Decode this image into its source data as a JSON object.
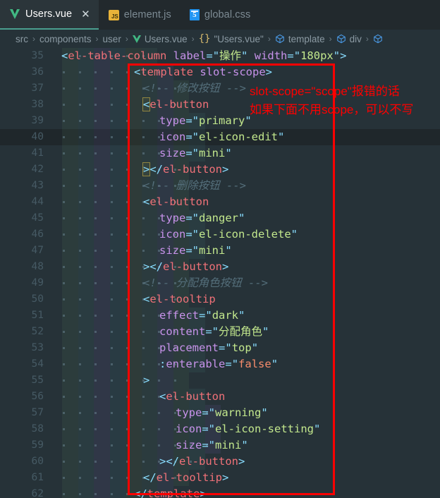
{
  "window": {
    "bg_color": "#263238",
    "accent_color": "#4a9e8f"
  },
  "tabs": [
    {
      "label": "Users.vue",
      "icon": "vue-icon",
      "active": true,
      "close_glyph": "✕"
    },
    {
      "label": "element.js",
      "icon": "js-icon",
      "active": false,
      "icon_text": "JS"
    },
    {
      "label": "global.css",
      "icon": "css-icon",
      "active": false,
      "icon_text": "5"
    }
  ],
  "breadcrumb": {
    "separator": "›",
    "items": [
      {
        "label": "src",
        "icon": ""
      },
      {
        "label": "components",
        "icon": ""
      },
      {
        "label": "user",
        "icon": ""
      },
      {
        "label": "Users.vue",
        "icon": "vue-icon"
      },
      {
        "label": "\"Users.vue\"",
        "icon": "braces-icon"
      },
      {
        "label": "template",
        "icon": "cube-icon"
      },
      {
        "label": "div",
        "icon": "cube-icon"
      },
      {
        "label": "",
        "icon": "cube-icon"
      }
    ]
  },
  "annotation": {
    "color": "#fe0000",
    "line1": "slot-scope=\"scope\"报错的话",
    "line2": "如果下面不用scope，可以不写"
  },
  "editor": {
    "current_line": 40,
    "first_line": 35,
    "last_line": 62,
    "language": "vue",
    "lines": [
      {
        "n": 35,
        "indents": 6,
        "text": "<el-table-column label=\"操作\" width=\"180px\">"
      },
      {
        "n": 36,
        "indents": 7,
        "text": "<template slot-scope>"
      },
      {
        "n": 37,
        "indents": 8,
        "text": "<!-- 修改按钮 --›"
      },
      {
        "n": 38,
        "indents": 8,
        "text": "<el-button"
      },
      {
        "n": 39,
        "indents": 9,
        "text": "type=\"primary\""
      },
      {
        "n": 40,
        "indents": 9,
        "text": "icon=\"el-icon-edit\""
      },
      {
        "n": 41,
        "indents": 9,
        "text": "size=\"mini\""
      },
      {
        "n": 42,
        "indents": 8,
        "text": "></el-button>"
      },
      {
        "n": 43,
        "indents": 8,
        "text": "<!-- 删除按钮 -->"
      },
      {
        "n": 44,
        "indents": 8,
        "text": "<el-button"
      },
      {
        "n": 45,
        "indents": 9,
        "text": "type=\"danger\""
      },
      {
        "n": 46,
        "indents": 9,
        "text": "icon=\"el-icon-delete\""
      },
      {
        "n": 47,
        "indents": 9,
        "text": "size=\"mini\""
      },
      {
        "n": 48,
        "indents": 8,
        "text": "></el-button>"
      },
      {
        "n": 49,
        "indents": 8,
        "text": "<!-- 分配角色按钮 -->"
      },
      {
        "n": 50,
        "indents": 8,
        "text": "<el-tooltip"
      },
      {
        "n": 51,
        "indents": 9,
        "text": "effect=\"dark\""
      },
      {
        "n": 52,
        "indents": 9,
        "text": "content=\"分配角色\""
      },
      {
        "n": 53,
        "indents": 9,
        "text": "placement=\"top\""
      },
      {
        "n": 54,
        "indents": 9,
        "text": ":enterable=\"false\""
      },
      {
        "n": 55,
        "indents": 8,
        "text": ">"
      },
      {
        "n": 56,
        "indents": 9,
        "text": "<el-button"
      },
      {
        "n": 57,
        "indents": 10,
        "text": "type=\"warning\""
      },
      {
        "n": 58,
        "indents": 10,
        "text": "icon=\"el-icon-setting\""
      },
      {
        "n": 59,
        "indents": 10,
        "text": "size=\"mini\""
      },
      {
        "n": 60,
        "indents": 9,
        "text": "></el-button>"
      },
      {
        "n": 61,
        "indents": 8,
        "text": "</el-tooltip>"
      },
      {
        "n": 62,
        "indents": 7,
        "text": "</template>"
      }
    ]
  }
}
